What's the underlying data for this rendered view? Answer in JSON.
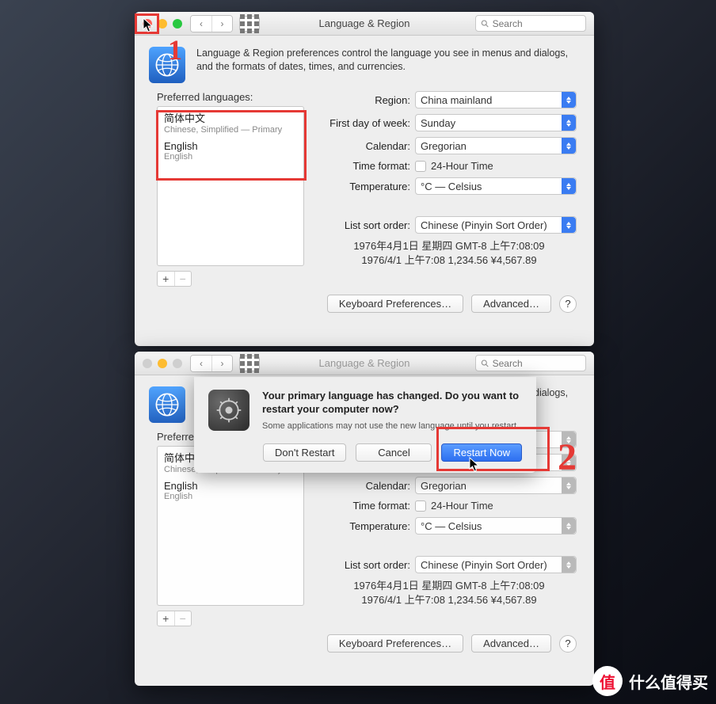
{
  "title": "Language & Region",
  "search_placeholder": "Search",
  "intro": "Language & Region preferences control the language you see in menus and dialogs, and the formats of dates, times, and currencies.",
  "left": {
    "label": "Preferred languages:",
    "items": [
      {
        "name": "简体中文",
        "sub": "Chinese, Simplified — Primary"
      },
      {
        "name": "English",
        "sub": "English"
      }
    ]
  },
  "rows": {
    "region_label": "Region:",
    "region_value": "China mainland",
    "firstday_label": "First day of week:",
    "firstday_value": "Sunday",
    "calendar_label": "Calendar:",
    "calendar_value": "Gregorian",
    "timefmt_label": "Time format:",
    "timefmt_check": "24-Hour Time",
    "temp_label": "Temperature:",
    "temp_value": "°C — Celsius",
    "sort_label": "List sort order:",
    "sort_value": "Chinese (Pinyin Sort Order)"
  },
  "sample": {
    "line1": "1976年4月1日 星期四 GMT-8 上午7:08:09",
    "line2": "1976/4/1 上午7:08    1,234.56    ¥4,567.89"
  },
  "footer": {
    "keyboard": "Keyboard Preferences…",
    "advanced": "Advanced…",
    "help": "?"
  },
  "sheet": {
    "heading": "Your primary language has changed. Do you want to restart your computer now?",
    "sub": "Some applications may not use the new language until you restart.",
    "dont": "Don't Restart",
    "cancel": "Cancel",
    "restart": "Restart Now"
  },
  "annotations": {
    "n1": "1",
    "n2": "2"
  },
  "watermark": {
    "logo": "值",
    "text": "什么值得买"
  }
}
